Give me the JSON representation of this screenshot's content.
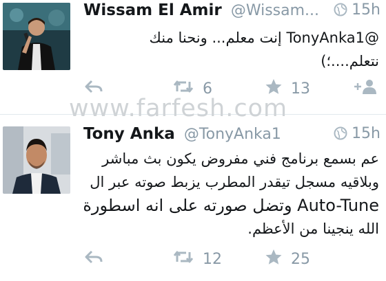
{
  "tweets": [
    {
      "author": "Wissam El Amir",
      "handle": "@Wissam...",
      "time": "15h",
      "text_lines": [
        "@TonyAnka1 إنت معلم... ونحنا منك",
        "نتعلم....؛)"
      ],
      "retweets": "6",
      "favorites": "13"
    },
    {
      "author": "Tony Anka",
      "handle": "@TonyAnka1",
      "time": "15h",
      "text_lines": [
        "عم بسمع برنامج فني مفروض يكون بث مباشر",
        "وبلاقيه مسجل تيقدر المطرب يزبط صوته عبر ال",
        "Auto-Tune وتضل صورته على انه اسطورة",
        "الله ينجينا من الأعظم."
      ],
      "retweets": "12",
      "favorites": "25"
    }
  ],
  "watermark": "www.farfesh.com",
  "colors": {
    "icon": "#aab8c2",
    "muted": "#8899a6",
    "text": "#14171a"
  }
}
